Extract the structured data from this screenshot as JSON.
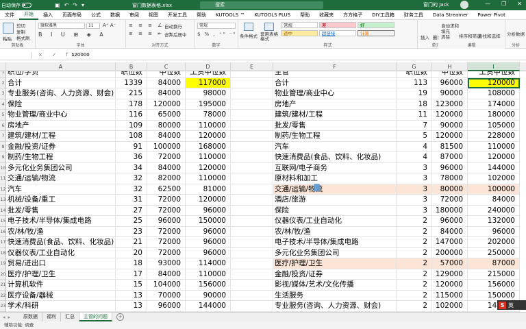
{
  "titlebar": {
    "autosave_label": "自动保存",
    "toggle_state": "关",
    "filename": "窗门数据表格.xlsx",
    "search_placeholder": "搜索",
    "user_name": "窗门的 Jack"
  },
  "ribbon_tabs": [
    "文件",
    "开始",
    "插入",
    "页面布局",
    "公式",
    "数据",
    "审阅",
    "视图",
    "开发工具",
    "帮助",
    "KUTOOLS ™",
    "KUTOOLS PLUS",
    "帮助",
    "收藏夹",
    "方方格子",
    "DIY工具箱",
    "财务工具",
    "Data Streamer",
    "Power Pivot"
  ],
  "active_tab": "开始",
  "ribbon": {
    "clipboard": {
      "paste": "粘贴",
      "cut": "剪切",
      "copy": "复制",
      "format_painter": "格式刷",
      "label": "剪贴板"
    },
    "font": {
      "name": "微软雅黑",
      "size": "11",
      "label": "字体"
    },
    "alignment": {
      "wrap": "自动换行",
      "merge": "合并后居中",
      "label": "对齐方式"
    },
    "number": {
      "format": "常规",
      "label": "数字"
    },
    "conditional": "条件格式",
    "table_format": "套用表格格式",
    "styles": {
      "normal": "常规",
      "bad": "差",
      "good": "好",
      "neutral": "适中",
      "hyperlink": "超链接",
      "calc": "计算",
      "label": "样式"
    },
    "cells": {
      "insert": "插入",
      "delete": "删除",
      "format": "格式",
      "label": "单元格"
    },
    "editing": {
      "autosum": "自动求和",
      "fill": "填充",
      "clear": "清除",
      "sort": "排序和筛选",
      "find": "查找和选择",
      "label": "编辑"
    },
    "analysis": {
      "analyze": "分析数据",
      "label": "分析"
    }
  },
  "formula_bar": {
    "name_box": "",
    "fx": "× ✓ fx",
    "value": "120000"
  },
  "columns": [
    "A",
    "B",
    "C",
    "D",
    "E",
    "F",
    "G",
    "H",
    "I"
  ],
  "selected_column": "I",
  "header_row": {
    "A": "职位/学负",
    "B": "职位数",
    "C": "中位数",
    "D": "工资中位数",
    "F": "主管",
    "G": "职位数",
    "H": "中位数",
    "I": "工资中位数"
  },
  "rows": [
    {
      "n": "2",
      "a": "合计",
      "b": "1339",
      "c": "84000",
      "d": "117000",
      "f": "合计",
      "g": "113",
      "h": "96000",
      "i": "120000"
    },
    {
      "n": "3",
      "a": "专业服务(咨询、人力资源、财会)",
      "b": "215",
      "c": "84000",
      "d": "98000",
      "f": "物业管理/商业中心",
      "g": "19",
      "h": "90000",
      "i": "108000"
    },
    {
      "n": "4",
      "a": "保险",
      "b": "178",
      "c": "120000",
      "d": "195000",
      "f": "房地产",
      "g": "18",
      "h": "123000",
      "i": "174000"
    },
    {
      "n": "5",
      "a": "物业管理/商业中心",
      "b": "116",
      "c": "65000",
      "d": "78000",
      "f": "建筑/建材/工程",
      "g": "11",
      "h": "120000",
      "i": "180000"
    },
    {
      "n": "6",
      "a": "房地产",
      "b": "109",
      "c": "80000",
      "d": "110000",
      "f": "批发/零售",
      "g": "7",
      "h": "90000",
      "i": "105000"
    },
    {
      "n": "7",
      "a": "建筑/建材/工程",
      "b": "108",
      "c": "84000",
      "d": "120000",
      "f": "制药/生物工程",
      "g": "5",
      "h": "120000",
      "i": "228000"
    },
    {
      "n": "8",
      "a": "金融/投资/证券",
      "b": "91",
      "c": "100000",
      "d": "168000",
      "f": "汽车",
      "g": "4",
      "h": "81500",
      "i": "110000"
    },
    {
      "n": "9",
      "a": "制药/生物工程",
      "b": "36",
      "c": "72000",
      "d": "110000",
      "f": "快速消费品(食品、饮料、化妆品)",
      "g": "4",
      "h": "87000",
      "i": "120000"
    },
    {
      "n": "10",
      "a": "多元化业务集团公司",
      "b": "34",
      "c": "84000",
      "d": "120000",
      "f": "互联网/电子商务",
      "g": "3",
      "h": "96000",
      "i": "144000"
    },
    {
      "n": "11",
      "a": "交通/运输/物流",
      "b": "32",
      "c": "82000",
      "d": "110000",
      "f": "原材料和加工",
      "g": "3",
      "h": "78000",
      "i": "102000"
    },
    {
      "n": "12",
      "a": "汽车",
      "b": "32",
      "c": "62500",
      "d": "81000",
      "f": "交通/运输/物流",
      "g": "3",
      "h": "80000",
      "i": "100000"
    },
    {
      "n": "13",
      "a": "机械/设备/重工",
      "b": "31",
      "c": "72000",
      "d": "120000",
      "f": "酒店/旅游",
      "g": "3",
      "h": "72000",
      "i": "84000"
    },
    {
      "n": "14",
      "a": "批发/零售",
      "b": "27",
      "c": "72000",
      "d": "96000",
      "f": "保险",
      "g": "3",
      "h": "180000",
      "i": "240000"
    },
    {
      "n": "15",
      "a": "电子技术/半导体/集成电路",
      "b": "25",
      "c": "96000",
      "d": "150000",
      "f": "仪器仪表/工业自动化",
      "g": "2",
      "h": "96000",
      "i": "132000"
    },
    {
      "n": "16",
      "a": "农/林/牧/渔",
      "b": "23",
      "c": "72000",
      "d": "96000",
      "f": "农/林/牧/渔",
      "g": "2",
      "h": "84000",
      "i": "96000"
    },
    {
      "n": "17",
      "a": "快速消费品(食品、饮料、化妆品)",
      "b": "21",
      "c": "72000",
      "d": "96000",
      "f": "电子技术/半导体/集成电路",
      "g": "2",
      "h": "147000",
      "i": "202000"
    },
    {
      "n": "18",
      "a": "仪器仪表/工业自动化",
      "b": "20",
      "c": "72000",
      "d": "96000",
      "f": "多元化业务集团公司",
      "g": "2",
      "h": "200000",
      "i": "250000"
    },
    {
      "n": "19",
      "a": "贸易/进出口",
      "b": "18",
      "c": "93000",
      "d": "114000",
      "f": "医疗/护理/卫生",
      "g": "2",
      "h": "57000",
      "i": "87000"
    },
    {
      "n": "20",
      "a": "医疗/护理/卫生",
      "b": "17",
      "c": "84000",
      "d": "110000",
      "f": "金融/投资/证券",
      "g": "2",
      "h": "129000",
      "i": "215000"
    },
    {
      "n": "21",
      "a": "计算机软件",
      "b": "15",
      "c": "104000",
      "d": "156000",
      "f": "影视/媒体/艺术/文化传播",
      "g": "2",
      "h": "120000",
      "i": "156000"
    },
    {
      "n": "22",
      "a": "医疗设备/器械",
      "b": "13",
      "c": "70000",
      "d": "90000",
      "f": "生活服务",
      "g": "2",
      "h": "115000",
      "i": "150000"
    },
    {
      "n": "23",
      "a": "学术/科研",
      "b": "13",
      "c": "96000",
      "d": "144000",
      "f": "专业服务(咨询、人力资源、财会)",
      "g": "2",
      "h": "102000",
      "i": "144000"
    }
  ],
  "highlight_colors": {
    "yellow": "#ffff00",
    "peach": "#fce4d6",
    "accent": "#1e6b3c"
  },
  "sheet_tabs": [
    "原数据",
    "福利",
    "汇总",
    "主管的问题"
  ],
  "active_sheet": "主管的问题",
  "status": "辅助功能: 调查",
  "ime": {
    "logo": "S",
    "label": "英"
  }
}
